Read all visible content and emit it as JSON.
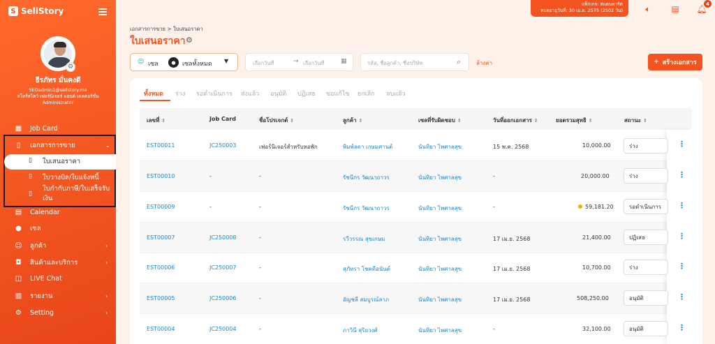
{
  "app": {
    "logo": "SellStory"
  },
  "user": {
    "name": "ธีรภัทร มั่นคงดี",
    "email": "SEOadmin1@sellstory.me",
    "company": "สโตร์สโตว์ เฟอร์นิเจอร์ แอนด์ เดคคอร์ชั่น",
    "role": "Administrator"
  },
  "topbar": {
    "package_line1": "แพ็กเกจ: สแตนดาร์ด",
    "package_line2": "หมดอายุวันที่: 30 เม.ย. 2575 (2502 วัน)",
    "notification_count": "4"
  },
  "sidebar": {
    "items": [
      {
        "label": "Job Card"
      },
      {
        "label": "เอกสารการขาย"
      },
      {
        "label": "ใบเสนอราคา"
      },
      {
        "label": "ใบวางบิล/ใบแจ้งหนี้"
      },
      {
        "label": "ใบกำกับภาษี/ใบเสร็จรับ"
      },
      {
        "label": "เงิน"
      },
      {
        "label": "Calendar"
      },
      {
        "label": "เซล"
      },
      {
        "label": "ลูกค้า"
      },
      {
        "label": "สินค้าและบริการ"
      },
      {
        "label": "LIVE Chat"
      },
      {
        "label": "รายงาน"
      },
      {
        "label": "Setting"
      }
    ]
  },
  "page": {
    "breadcrumb": "เอกสารการขาย > ใบเสนอราคา",
    "title": "ใบเสนอราคา"
  },
  "filters": {
    "sales_label": "เซล",
    "sales_value": "เซลทั้งหมด",
    "date_from_placeholder": "เลือกวันที่",
    "date_to_placeholder": "เลือกวันที่",
    "search_placeholder": "รหัส, ชื่อลูกค้า, ชื่อบริษัท",
    "clear_label": "ล้างค่า",
    "create_label": "สร้างเอกสาร"
  },
  "tabs": [
    "ทั้งหมด",
    "ร่าง",
    "รอดำเนินการ",
    "ส่งแล้ว",
    "อนุมัติ",
    "ปฏิเสธ",
    "ขอแก้ไข",
    "ยกเลิก",
    "ลบแล้ว"
  ],
  "table": {
    "headers": [
      "เลขที่",
      "Job Card",
      "ชื่อโปรเจกต์",
      "ลูกค้า",
      "เซลที่รับผิดชอบ",
      "วันที่ออกเอกสาร",
      "ยอดรวมสุทธิ",
      "สถานะ"
    ],
    "rows": [
      {
        "no": "EST00011",
        "job": "JC250003",
        "project": "เฟอร์นิเจอร์สำหรับหอพัก",
        "customer": "พิมพ์ลดา เกษมศานต์",
        "sales": "นันทิยา ไพศาลสุข",
        "date": "15 พ.ค. 2568",
        "total": "10,000.00",
        "status": "ร่าง"
      },
      {
        "no": "EST00010",
        "job": "-",
        "project": "-",
        "customer": "รัชนีกร วัฒนาถาวร",
        "sales": "นันทิยา ไพศาลสุข",
        "date": "-",
        "total": "20,000.00",
        "status": "ร่าง"
      },
      {
        "no": "EST00009",
        "job": "-",
        "project": "-",
        "customer": "รัชนีกร วัฒนาถาวร",
        "sales": "นันทิยา ไพศาลสุข",
        "date": "-",
        "total": "59,181.20",
        "status": "รอดำเนินการ"
      },
      {
        "no": "EST00007",
        "job": "JC250008",
        "project": "-",
        "customer": "รวีวรรณ สุขเกษม",
        "sales": "นันทิยา ไพศาลสุข",
        "date": "17 เม.ย. 2568",
        "total": "21,400.00",
        "status": "ปฏิเสธ"
      },
      {
        "no": "EST00006",
        "job": "JC250007",
        "project": "-",
        "customer": "สุภัทรา โชคดีอนันต์",
        "sales": "นันทิยา ไพศาลสุข",
        "date": "17 เม.ย. 2568",
        "total": "10,700.00",
        "status": "ร่าง"
      },
      {
        "no": "EST00005",
        "job": "JC250006",
        "project": "-",
        "customer": "อัญชลี สมบูรณ์ลาภ",
        "sales": "นันทิยา ไพศาลสุข",
        "date": "17 เม.ย. 2568",
        "total": "508,250.00",
        "status": "อนุมัติ"
      },
      {
        "no": "EST00004",
        "job": "JC250004",
        "project": "-",
        "customer": "ภาวินี สุริยวงศ์",
        "sales": "นันทิยา ไพศาลสุข",
        "date": "-",
        "total": "32,100.00",
        "status": "อนุมัติ"
      }
    ]
  },
  "colors": {
    "accent": "#f2531f",
    "link": "#1a87c9"
  }
}
